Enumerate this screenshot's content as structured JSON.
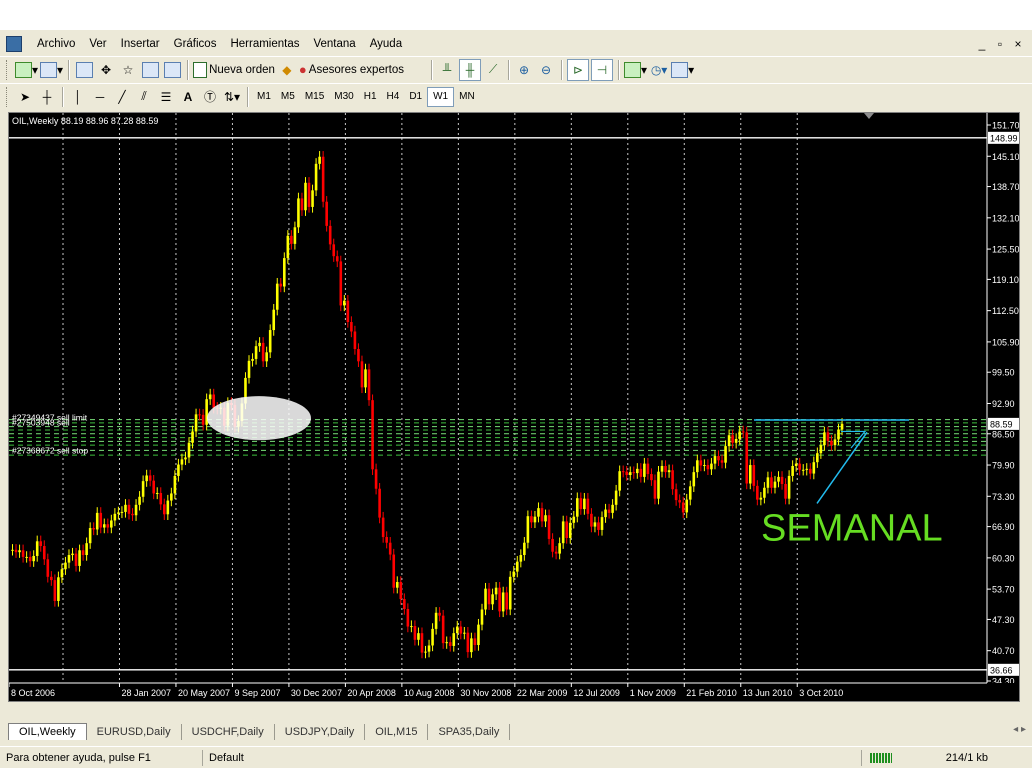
{
  "menu": [
    "Archivo",
    "Ver",
    "Insertar",
    "Gráficos",
    "Herramientas",
    "Ventana",
    "Ayuda"
  ],
  "window_controls": [
    "_",
    "▫",
    "×"
  ],
  "toolbar": {
    "new_order": "Nueva orden",
    "expert_advisors": "Asesores expertos"
  },
  "timeframes": [
    "M1",
    "M5",
    "M15",
    "M30",
    "H1",
    "H4",
    "D1",
    "W1",
    "MN"
  ],
  "active_timeframe": "W1",
  "chart": {
    "header": "OIL,Weekly  88.19 88.96 87.28 88.59",
    "overlay_text": "SEMANAL",
    "overlay_color": "#66dd22",
    "bull_color": "#ffff00",
    "bear_color": "#ff0000",
    "orders": [
      "#27349437 sell limit",
      "#27503948 sell",
      "#27368672 sell stop"
    ]
  },
  "chart_data": {
    "type": "candlestick",
    "y_ticks": [
      "151.70",
      "145.10",
      "138.70",
      "132.10",
      "125.50",
      "119.10",
      "112.50",
      "105.90",
      "99.50",
      "92.90",
      "86.50",
      "79.90",
      "73.30",
      "66.90",
      "60.30",
      "53.70",
      "47.30",
      "40.70",
      "34.30"
    ],
    "y_range": [
      34.3,
      151.7
    ],
    "x_ticks": [
      "8 Oct 2006",
      "28 Jan 2007",
      "20 May 2007",
      "9 Sep 2007",
      "30 Dec 2007",
      "20 Apr 2008",
      "10 Aug 2008",
      "30 Nov 2008",
      "22 Mar 2009",
      "12 Jul 2009",
      "1 Nov 2009",
      "21 Feb 2010",
      "13 Jun 2010",
      "3 Oct 2010"
    ],
    "price_labels": {
      "high": "148.99",
      "current": "88.59",
      "low": "36.66"
    },
    "high_line": 148.99,
    "low_line": 36.66,
    "current_price": 88.59,
    "order_levels": [
      89.5,
      88.8,
      88.0,
      87.3,
      86.5,
      85.7,
      84.9,
      84.1,
      83.0,
      82.0
    ],
    "closes": [
      62.0,
      61.5,
      61.9,
      60.5,
      60.5,
      59.6,
      60.7,
      63.8,
      62.8,
      60.0,
      56.3,
      55.6,
      51.2,
      56.2,
      57.9,
      59.3,
      60.9,
      61.2,
      58.6,
      61.9,
      60.9,
      63.4,
      66.6,
      66.3,
      69.8,
      66.7,
      67.4,
      66.7,
      68.2,
      69.6,
      69.9,
      70.0,
      71.5,
      69.6,
      69.3,
      71.5,
      73.2,
      76.5,
      77.7,
      76.6,
      73.9,
      74.0,
      71.6,
      69.5,
      72.4,
      73.9,
      77.6,
      80.0,
      81.1,
      81.5,
      84.6,
      87.0,
      90.6,
      90.5,
      88.4,
      93.8,
      94.8,
      92.0,
      91.8,
      92.0,
      88.2,
      93.0,
      92.6,
      88.0,
      89.2,
      92.9,
      98.3,
      101.9,
      102.3,
      105.0,
      105.7,
      101.8,
      103.7,
      108.4,
      112.7,
      118.2,
      117.6,
      123.6,
      128.3,
      126.6,
      130.1,
      136.2,
      133.7,
      139.5,
      134.4,
      137.9,
      143.5,
      145.0,
      135.5,
      130.4,
      126.5,
      124.0,
      122.9,
      113.6,
      114.6,
      110.1,
      108.1,
      104.4,
      101.8,
      96.3,
      100.1,
      93.6,
      79.0,
      74.9,
      68.8,
      64.7,
      63.5,
      61.0,
      54.0,
      55.2,
      51.6,
      49.5,
      45.8,
      45.9,
      43.0,
      44.4,
      40.3,
      40.5,
      41.8,
      45.3,
      48.7,
      48.1,
      42.3,
      42.5,
      41.7,
      44.4,
      45.8,
      44.3,
      44.5,
      40.4,
      43.3,
      41.9,
      46.2,
      49.4,
      53.8,
      50.5,
      52.6,
      54.0,
      49.0,
      53.0,
      49.4,
      56.3,
      57.4,
      59.5,
      60.9,
      63.5,
      69.1,
      67.8,
      69.0,
      70.8,
      68.0,
      69.3,
      64.3,
      61.6,
      61.2,
      63.4,
      68.0,
      64.5,
      67.7,
      69.0,
      72.9,
      70.6,
      72.8,
      69.6,
      66.9,
      67.8,
      66.2,
      68.9,
      70.5,
      69.8,
      71.5,
      74.5,
      78.6,
      78.5,
      77.8,
      78.4,
      78.2,
      79.1,
      77.4,
      80.2,
      78.0,
      76.7,
      72.8,
      78.5,
      79.7,
      78.4,
      78.8,
      74.8,
      72.5,
      72.0,
      69.9,
      72.6,
      75.4,
      78.4,
      80.9,
      79.8,
      79.9,
      79.0,
      80.2,
      81.8,
      80.9,
      80.4,
      83.9,
      86.2,
      84.6,
      85.4,
      87.0,
      86.8,
      76.0,
      79.9,
      75.5,
      72.6,
      73.0,
      75.1,
      77.3,
      75.1,
      76.4,
      77.4,
      75.9,
      72.8,
      77.6,
      79.7,
      80.2,
      78.9,
      78.9,
      79.1,
      78.1,
      80.5,
      82.4,
      84.1,
      86.8,
      85.0,
      84.1,
      85.3,
      87.4,
      88.6
    ]
  }
}
